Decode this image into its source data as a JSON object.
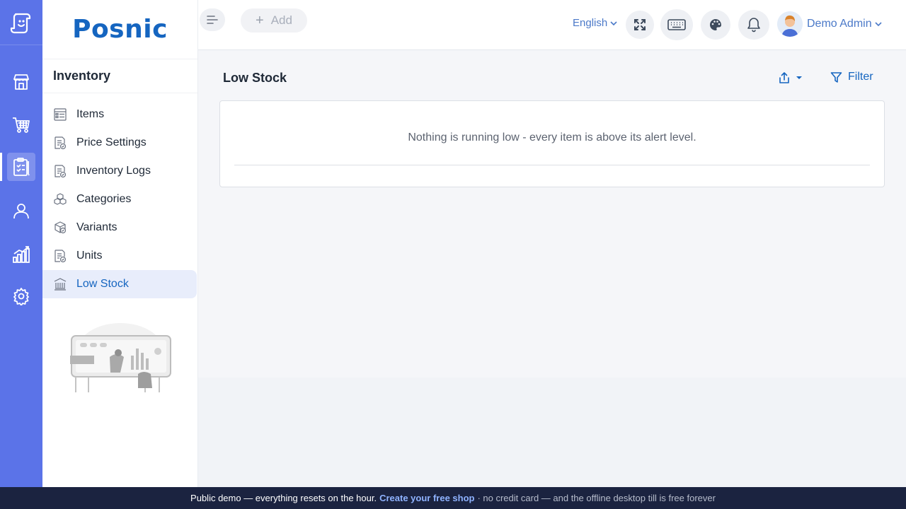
{
  "app": {
    "brand": "Posnic"
  },
  "rail": {
    "items": [
      {
        "icon": "store-icon",
        "active": false
      },
      {
        "icon": "cart-icon",
        "active": false
      },
      {
        "icon": "inventory-clipboard-icon",
        "active": true
      },
      {
        "icon": "user-icon",
        "active": false
      },
      {
        "icon": "analytics-icon",
        "active": false
      },
      {
        "icon": "gear-icon",
        "active": false
      }
    ]
  },
  "sidebar": {
    "title": "Inventory",
    "items": [
      {
        "label": "Items",
        "icon": "items-list-icon"
      },
      {
        "label": "Price Settings",
        "icon": "price-doc-icon"
      },
      {
        "label": "Inventory Logs",
        "icon": "logs-doc-icon"
      },
      {
        "label": "Categories",
        "icon": "categories-cubes-icon"
      },
      {
        "label": "Variants",
        "icon": "variants-box-icon"
      },
      {
        "label": "Units",
        "icon": "units-doc-icon"
      },
      {
        "label": "Low Stock",
        "icon": "low-stock-icon",
        "active": true
      }
    ]
  },
  "header": {
    "add_label": "Add",
    "language": "English",
    "user_name": "Demo Admin"
  },
  "main": {
    "title": "Low Stock",
    "filter_label": "Filter",
    "empty_message": "Nothing is running low - every item is above its alert level."
  },
  "banner": {
    "text_start": "Public demo — everything resets on the hour.",
    "link": "Create your free shop",
    "text_end": "· no credit card — and the offline desktop till is free forever"
  },
  "colors": {
    "rail": "#5b73e8",
    "brand": "#1565c0",
    "active_bg": "#e8edfb",
    "banner": "#1b2340"
  }
}
